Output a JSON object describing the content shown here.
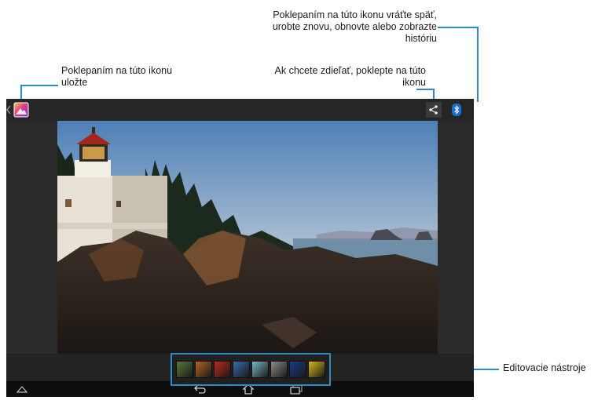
{
  "callouts": {
    "save": "Poklepaním na túto ikonu uložte",
    "share": "Ak chcete zdieľať, poklepte na túto ikonu",
    "history": "Poklepaním na túto ikonu vráťte späť, urobte znovu, obnovte alebo zobrazte históriu",
    "tools": "Editovacie nástroje"
  },
  "icons": {
    "back": "chevron-left-icon",
    "app": "gallery-app-icon",
    "share": "share-icon",
    "bluetooth": "bluetooth-icon",
    "overflow": "overflow-menu-icon",
    "nav_up": "home-up-icon",
    "nav_back": "back-nav-icon",
    "nav_home": "home-icon",
    "nav_recent": "recent-apps-icon"
  },
  "edit_tools": {
    "count": 8,
    "thumb_colors": [
      "#5a7a3a",
      "#b8641e",
      "#c0281e",
      "#3a6aa8",
      "#7ab8c8",
      "#8a8a88",
      "#1e3a8a",
      "#d8b818"
    ]
  },
  "colors": {
    "accent": "#2f8ac5",
    "bluetooth_badge": "#1a6fd0"
  }
}
